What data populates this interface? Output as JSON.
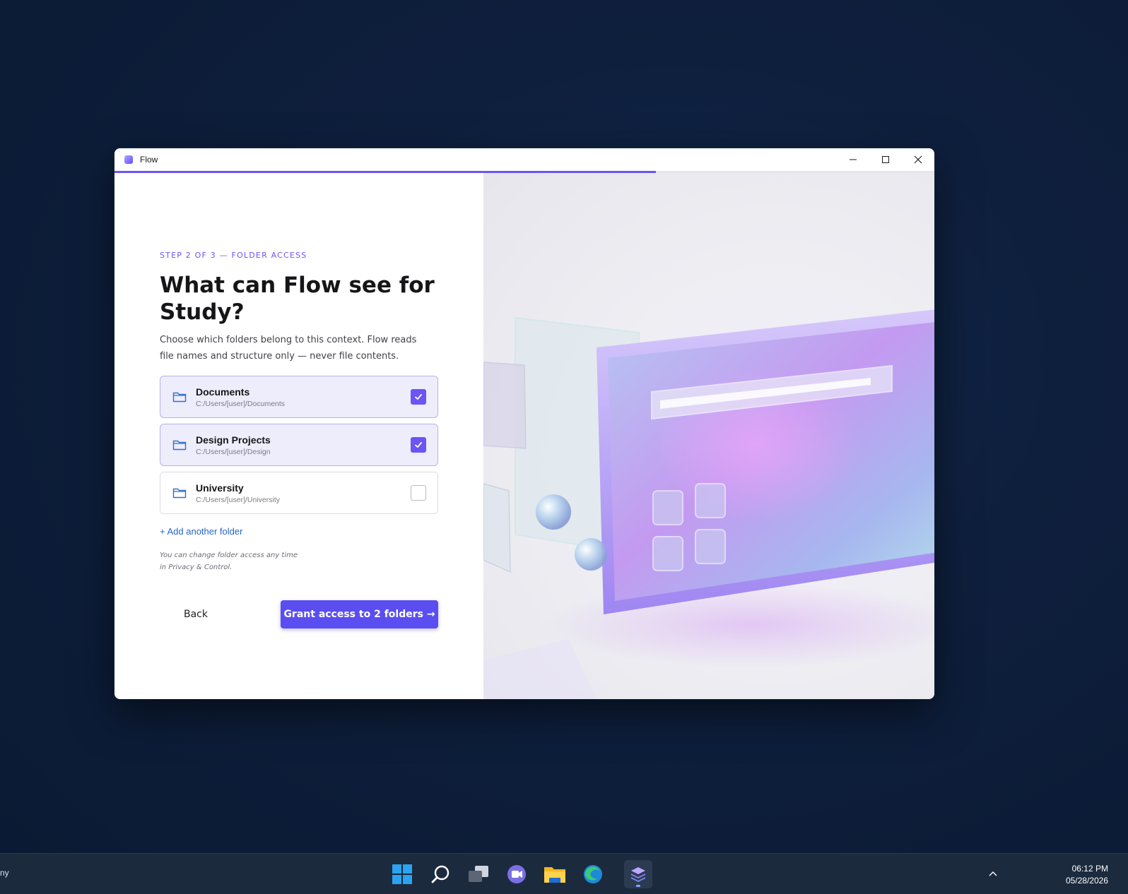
{
  "window": {
    "title": "Flow",
    "progress_fraction": 0.66
  },
  "onboarding": {
    "step_label": "STEP 2 OF 3 — FOLDER ACCESS",
    "heading": "What can Flow see for Study?",
    "description": "Choose which folders belong to this context. Flow reads file names and structure only — never file contents.",
    "folders": [
      {
        "name": "Documents",
        "path": "C:/Users/[user]/Documents",
        "checked": true
      },
      {
        "name": "Design Projects",
        "path": "C:/Users/[user]/Design",
        "checked": true
      },
      {
        "name": "University",
        "path": "C:/Users/[user]/University",
        "checked": false
      }
    ],
    "add_folder_label": "+ Add another folder",
    "note": "You can change folder access any time in Privacy & Control.",
    "back_label": "Back",
    "grant_label": "Grant access to 2 folders →"
  },
  "taskbar": {
    "left_text": "ny",
    "icons": [
      "windows-start-icon",
      "search-icon",
      "task-view-icon",
      "chat-icon",
      "file-explorer-icon",
      "edge-icon",
      "flow-app-icon"
    ],
    "time": "06:12 PM",
    "date": "05/28/2026"
  },
  "colors": {
    "accent": "#6a55f5",
    "primary_button": "#5b4ef0",
    "link": "#2565c6",
    "desktop": "#0e1f3d",
    "taskbar": "#1c2a3e"
  }
}
